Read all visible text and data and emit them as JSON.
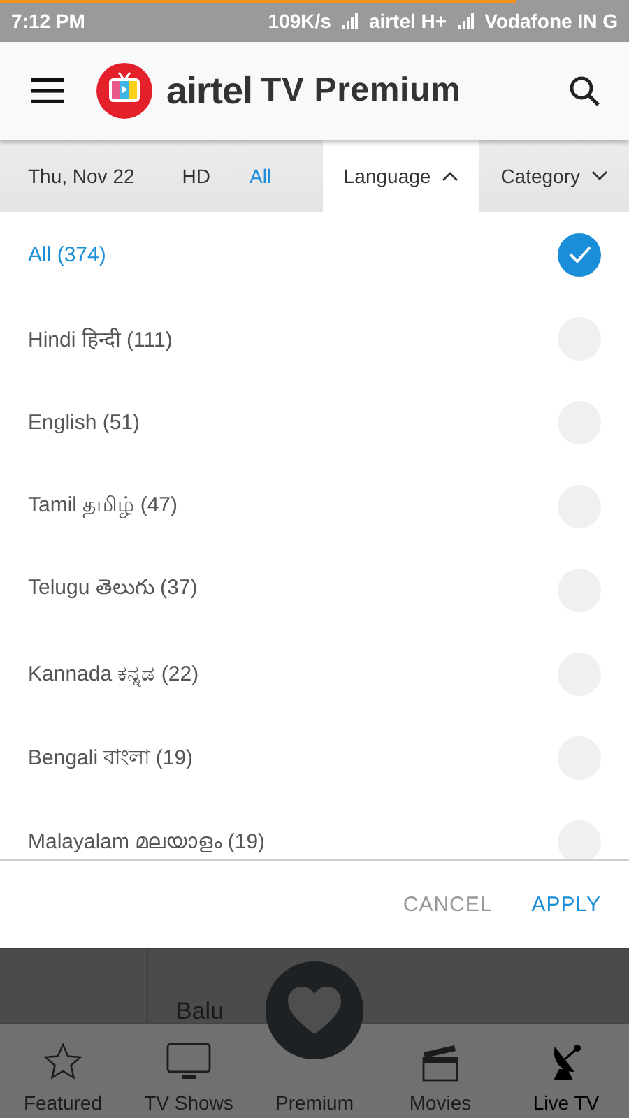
{
  "status_bar": {
    "time": "7:12 PM",
    "speed": "109K/s",
    "carrier_1": "airtel H+",
    "carrier_2": "Vodafone IN G"
  },
  "load_progress": {
    "level": 0.82
  },
  "header": {
    "brand": "airtel",
    "title": "TV Premium"
  },
  "filter_bar": {
    "date": "Thu, Nov 22",
    "toggles": [
      {
        "label": "HD",
        "selected": false
      },
      {
        "label": "All",
        "selected": true
      }
    ],
    "dropdowns": [
      {
        "label": "Language",
        "expanded": true
      },
      {
        "label": "Category",
        "expanded": false
      }
    ]
  },
  "languages": [
    {
      "label": "All (374)",
      "selected": true
    },
    {
      "label": "Hindi हिन्दी (111)",
      "selected": false
    },
    {
      "label": "English (51)",
      "selected": false
    },
    {
      "label": "Tamil தமிழ் (47)",
      "selected": false
    },
    {
      "label": "Telugu తెలుగు (37)",
      "selected": false
    },
    {
      "label": "Kannada ಕನ್ನಡ (22)",
      "selected": false
    },
    {
      "label": "Bengali বাংলা (19)",
      "selected": false
    },
    {
      "label": "Malayalam മലയാളം (19)",
      "selected": false
    }
  ],
  "actions": [
    {
      "label": "CANCEL",
      "kind": "secondary"
    },
    {
      "label": "APPLY",
      "kind": "primary"
    }
  ],
  "background": {
    "program_title": "Balu"
  },
  "bottom_nav": [
    {
      "label": "Featured",
      "kind": "tab",
      "selected": false
    },
    {
      "label": "TV Shows",
      "kind": "tab",
      "selected": false
    },
    {
      "label": "Premium",
      "kind": "raised",
      "selected": false
    },
    {
      "label": "Movies",
      "kind": "tab",
      "selected": false
    },
    {
      "label": "Live TV",
      "kind": "tab",
      "selected": true
    }
  ]
}
